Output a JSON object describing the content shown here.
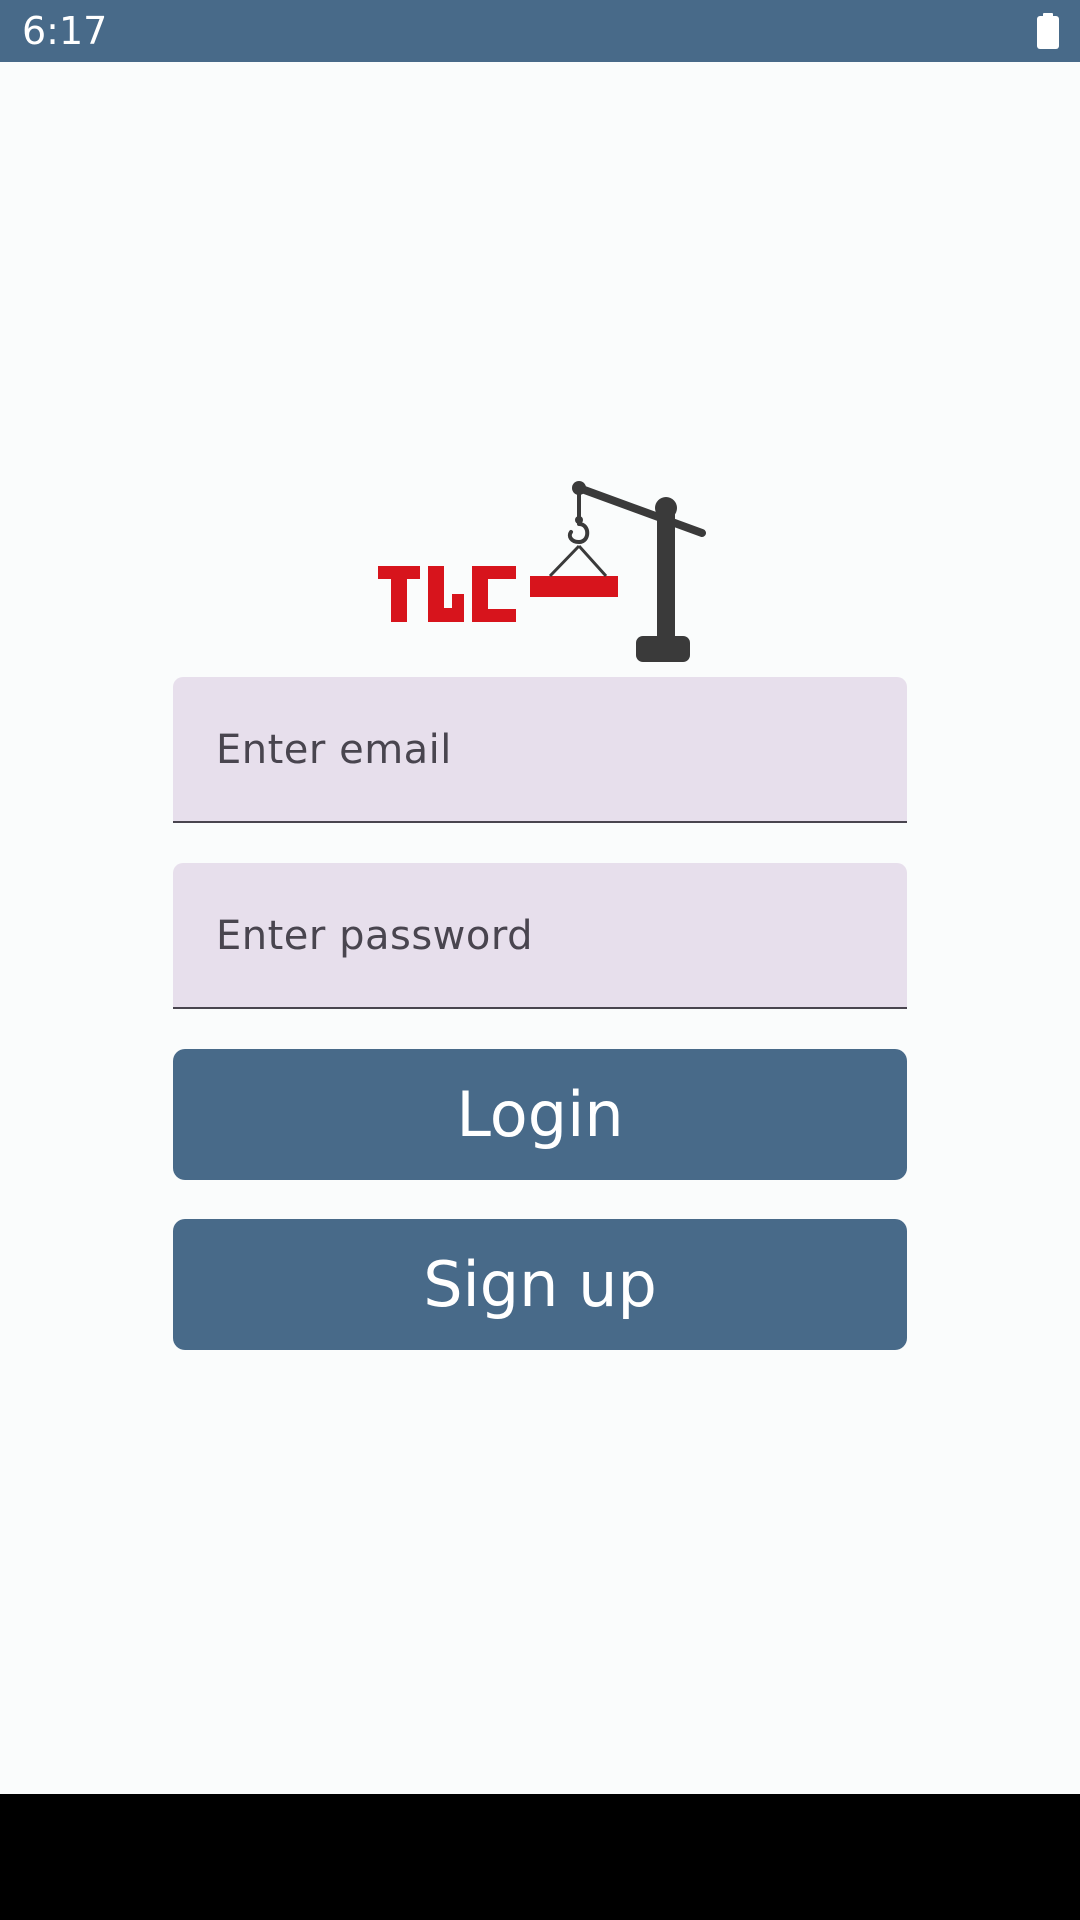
{
  "status_bar": {
    "time": "6:17",
    "battery_icon": "battery-full-icon",
    "background": "#486a89"
  },
  "logo": {
    "text": "TLC",
    "icon": "crane-logo-icon",
    "brand_red": "#d7141c",
    "crane_gray": "#3a3a3a"
  },
  "login_form": {
    "email_placeholder": "Enter email",
    "password_placeholder": "Enter password",
    "login_label": "Login",
    "signup_label": "Sign up"
  },
  "colors": {
    "accent": "#486a89",
    "field_background": "#e7dfec",
    "page_background": "#fafcfc"
  }
}
